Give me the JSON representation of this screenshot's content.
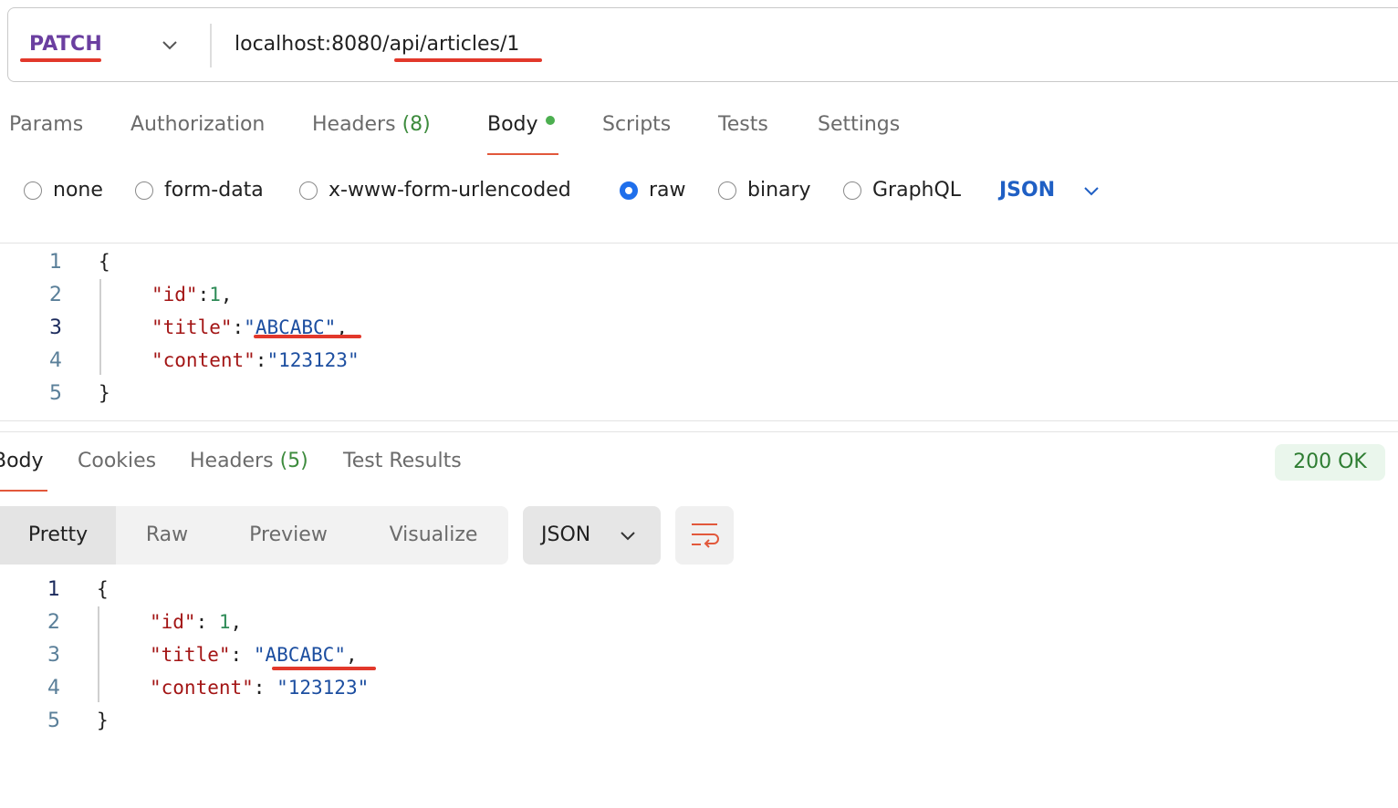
{
  "request": {
    "method": "PATCH",
    "url": "localhost:8080/api/articles/1",
    "tabs": [
      {
        "label": "Params",
        "count": ""
      },
      {
        "label": "Authorization",
        "count": ""
      },
      {
        "label": "Headers",
        "count": "(8)"
      },
      {
        "label": "Body",
        "count": ""
      },
      {
        "label": "Scripts",
        "count": ""
      },
      {
        "label": "Tests",
        "count": ""
      },
      {
        "label": "Settings",
        "count": ""
      }
    ],
    "active_tab": "Body",
    "body_types": [
      "none",
      "form-data",
      "x-www-form-urlencoded",
      "raw",
      "binary",
      "GraphQL"
    ],
    "selected_body_type": "raw",
    "body_format": "JSON",
    "body_lines": {
      "l1": "1",
      "l2": "2",
      "l3": "3",
      "l4": "4",
      "l5": "5",
      "open": "{",
      "id_key": "\"id\"",
      "id_val": "1",
      "title_key": "\"title\"",
      "title_val": "\"ABCABC\"",
      "content_key": "\"content\"",
      "content_val": "\"123123\"",
      "close": "}"
    }
  },
  "response": {
    "tabs": [
      {
        "label": "Body",
        "count": ""
      },
      {
        "label": "Cookies",
        "count": ""
      },
      {
        "label": "Headers",
        "count": "(5)"
      },
      {
        "label": "Test Results",
        "count": ""
      }
    ],
    "status": "200 OK",
    "views": [
      "Pretty",
      "Raw",
      "Preview",
      "Visualize"
    ],
    "active_view": "Pretty",
    "format": "JSON",
    "body_lines": {
      "l1": "1",
      "l2": "2",
      "l3": "3",
      "l4": "4",
      "l5": "5",
      "open": "{",
      "id_key": "\"id\"",
      "id_val": "1",
      "title_key": "\"title\"",
      "title_val": "\"ABCABC\"",
      "content_key": "\"content\"",
      "content_val": "\"123123\"",
      "close": "}"
    }
  },
  "colors": {
    "method": "#6b3fa0",
    "highlight_underline": "#e2382b",
    "status_ok": "#2e7d32",
    "radio_selected": "#1f6feb"
  },
  "icons": [
    "chevron-down-icon",
    "wrap-lines-icon"
  ]
}
